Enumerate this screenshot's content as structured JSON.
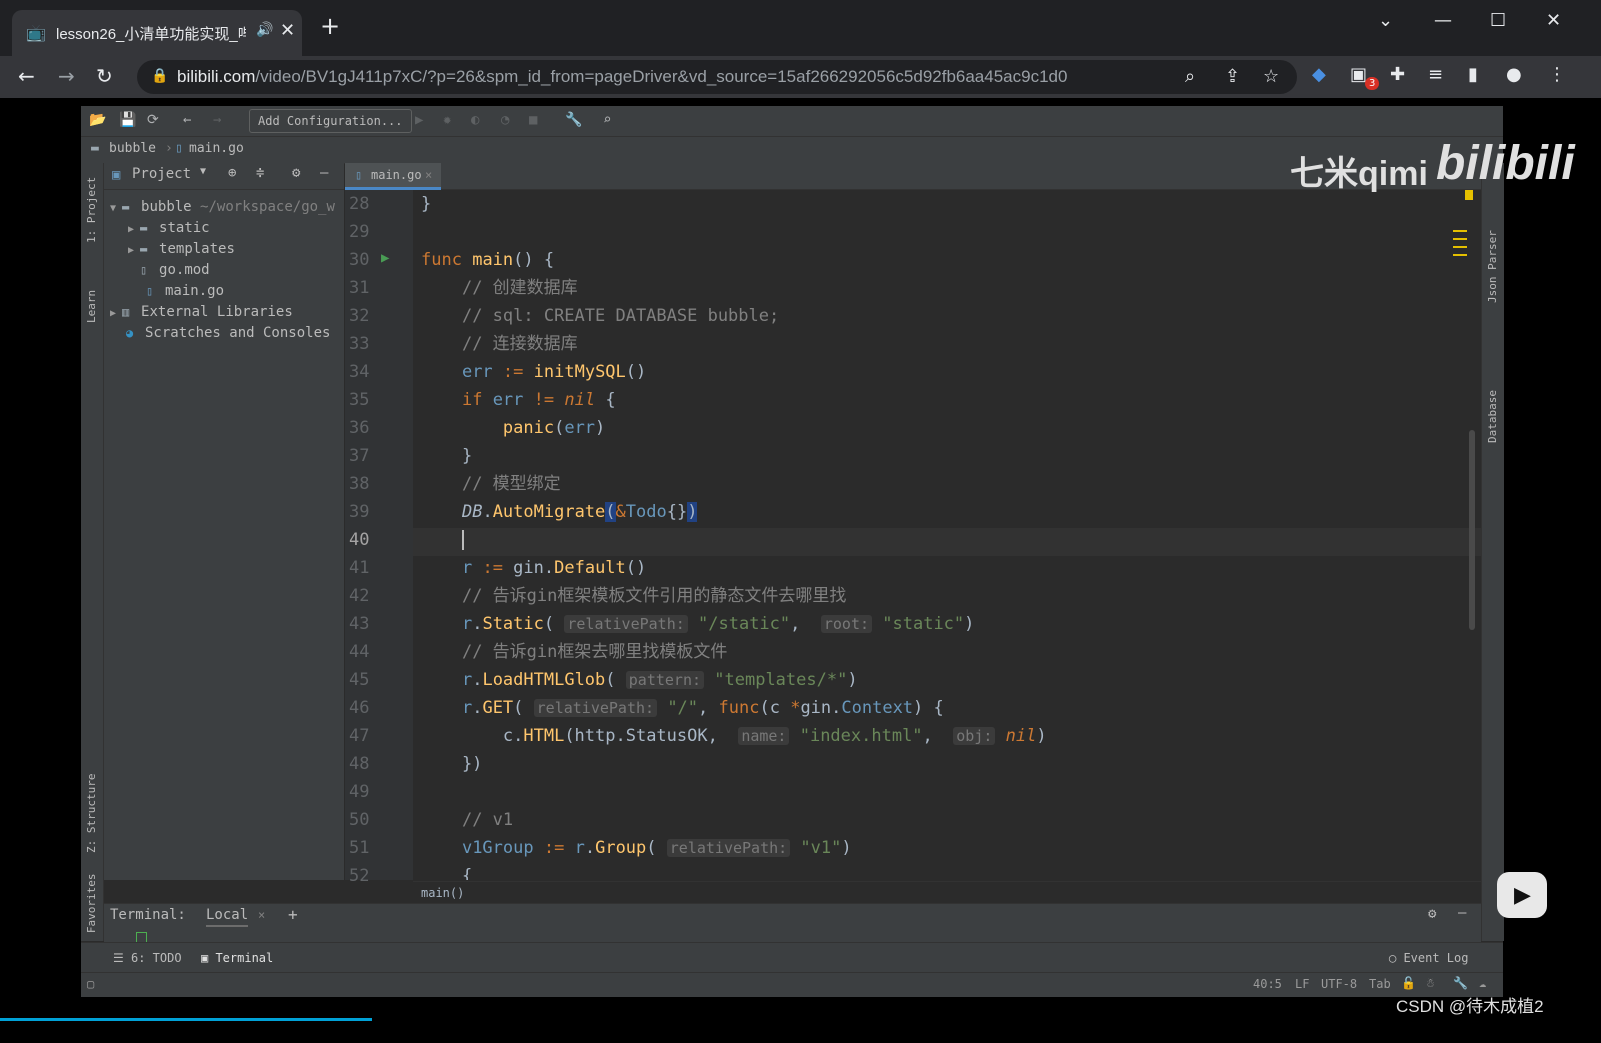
{
  "browser": {
    "tab_title": "lesson26_小清单功能实现_哔",
    "url_host": "bilibili.com",
    "url_path": "/video/BV1gJ411p7xC/?p=26&spm_id_from=pageDriver&vd_source=15af266292056c5d92fb6aa45ac9c1d0",
    "ext_badge": "3"
  },
  "toolbar": {
    "add_config": "Add Configuration..."
  },
  "breadcrumb": {
    "project": "bubble",
    "file": "main.go"
  },
  "left_strip": {
    "project": "1: Project",
    "learn": "Learn",
    "structure": "Z: Structure",
    "favorites": "2: Favorites"
  },
  "right_strip": {
    "parser": "Json Parser",
    "database": "Database"
  },
  "project_panel": {
    "header": "Project",
    "tree": [
      {
        "label": "bubble",
        "sub": "~/workspace/go_w"
      },
      {
        "label": "static"
      },
      {
        "label": "templates"
      },
      {
        "label": "go.mod"
      },
      {
        "label": "main.go"
      },
      {
        "label": "External Libraries"
      },
      {
        "label": "Scratches and Consoles"
      }
    ]
  },
  "editor": {
    "tab": "main.go",
    "line_numbers": [
      "28",
      "29",
      "30",
      "31",
      "32",
      "33",
      "34",
      "35",
      "36",
      "37",
      "38",
      "39",
      "40",
      "41",
      "42",
      "43",
      "44",
      "45",
      "46",
      "47",
      "48",
      "49",
      "50",
      "51",
      "52"
    ],
    "current_line": "40",
    "comments": {
      "c31": "// 创建数据库",
      "c32": "// sql: CREATE DATABASE bubble;",
      "c33": "// 连接数据库",
      "c38": "// 模型绑定",
      "c42": "// 告诉gin框架模板文件引用的静态文件去哪里找",
      "c44": "// 告诉gin框架去哪里找模板文件",
      "c50": "// v1"
    },
    "hints": {
      "relativePath": "relativePath:",
      "root": "root:",
      "pattern": "pattern:",
      "name": "name:",
      "obj": "obj:"
    },
    "strings": {
      "static_path": "\"/static\"",
      "static_root": "\"static\"",
      "templates": "\"templates/*\"",
      "root_path": "\"/\"",
      "index": "\"index.html\"",
      "v1": "\"v1\""
    },
    "breadcrumb_fn": "main()"
  },
  "terminal": {
    "label": "Terminal:",
    "tab": "Local"
  },
  "bottom_tools": {
    "todo": "6: TODO",
    "terminal": "Terminal",
    "event_log": "Event Log"
  },
  "status": {
    "position": "40:5",
    "line_sep": "LF",
    "encoding": "UTF-8",
    "indent": "Tab"
  },
  "watermark": {
    "uploader": "七米qimi",
    "brand": "bilibili",
    "csdn": "CSDN @待木成植2"
  }
}
